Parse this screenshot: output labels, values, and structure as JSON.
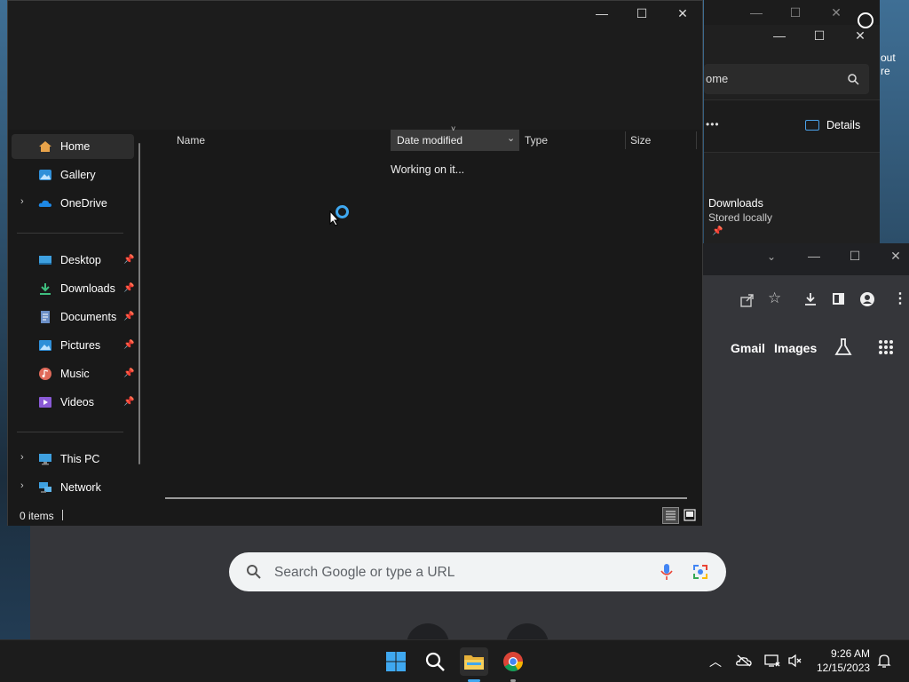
{
  "explorer": {
    "controls": {
      "minimize": "—",
      "maximize": "☐",
      "close": "✕"
    },
    "nav": {
      "home": "Home",
      "gallery": "Gallery",
      "onedrive": "OneDrive",
      "quick": [
        {
          "label": "Desktop",
          "icon": "desktop-icon"
        },
        {
          "label": "Downloads",
          "icon": "downloads-icon"
        },
        {
          "label": "Documents",
          "icon": "documents-icon"
        },
        {
          "label": "Pictures",
          "icon": "pictures-icon"
        },
        {
          "label": "Music",
          "icon": "music-icon"
        },
        {
          "label": "Videos",
          "icon": "videos-icon"
        }
      ],
      "this_pc": "This PC",
      "network": "Network"
    },
    "columns": {
      "name": "Name",
      "date": "Date modified",
      "type": "Type",
      "size": "Size"
    },
    "working": "Working on it...",
    "status": "0 items"
  },
  "bg_explorer": {
    "search_text": "ome",
    "cmd_more": "•••",
    "details": "Details",
    "item_name": "Downloads",
    "item_sub": "Stored locally",
    "partial_text_1": "out",
    "partial_text_2": "re"
  },
  "chrome": {
    "links": {
      "gmail": "Gmail",
      "images": "Images"
    },
    "search_placeholder": "Search Google or type a URL"
  },
  "taskbar": {
    "time": "9:26 AM",
    "date": "12/15/2023"
  },
  "colors": {
    "accent": "#0a84d8",
    "selected": "#2d2d2d",
    "sort_col": "#3a3a3a"
  }
}
